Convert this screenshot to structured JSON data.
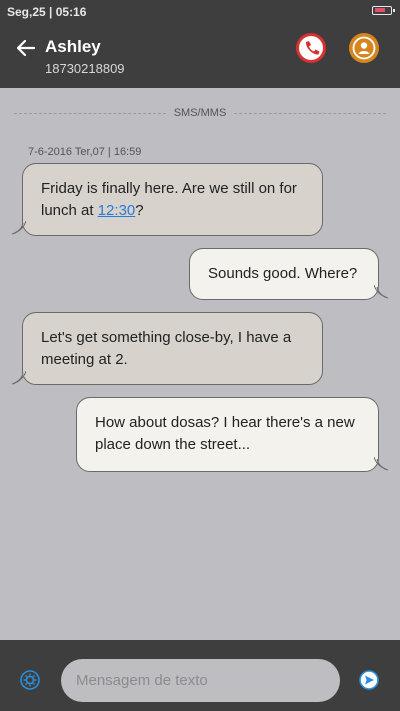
{
  "status_bar": {
    "datetime": "Seg,25 | 05:16",
    "battery_level": 0.7,
    "battery_color": "#e0506a"
  },
  "header": {
    "back_icon": "arrow-left-icon",
    "contact_name": "Ashley",
    "contact_number": "18730218809",
    "call_icon": "phone-icon",
    "contact_icon": "person-icon"
  },
  "thread": {
    "divider_label": "SMS/MMS",
    "timestamp": "7-6-2016 Ter,07 | 16:59",
    "messages": [
      {
        "direction": "incoming",
        "text_before_link": "Friday is finally here. Are we still on for lunch at ",
        "link_text": "12:30",
        "text_after_link": "?"
      },
      {
        "direction": "outgoing",
        "text": "Sounds good. Where?"
      },
      {
        "direction": "incoming",
        "text": "Let's get something close-by, I have a meeting at 2."
      },
      {
        "direction": "outgoing",
        "text": "How about dosas? I hear there's a new place down the street..."
      }
    ]
  },
  "composer": {
    "placeholder": "Mensagem de texto",
    "value": "",
    "attach_icon": "attachment-icon",
    "send_icon": "send-icon"
  },
  "colors": {
    "bar_background": "#3e3e3e",
    "thread_background": "#bdbdc2",
    "incoming_bubble": "#d7d3cc",
    "outgoing_bubble": "#f4f2ec",
    "link": "#2b7ad6",
    "call_accent": "#d8312f",
    "contact_accent": "#d5861f",
    "composer_icon": "#2a8fd8"
  }
}
